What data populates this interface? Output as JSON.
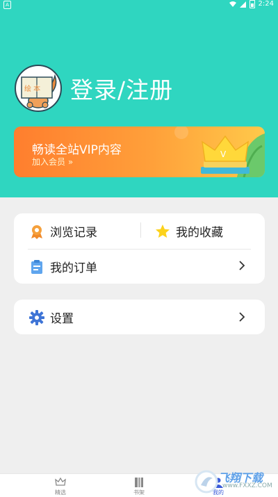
{
  "status_bar": {
    "left_icon": "A",
    "time": "2:24"
  },
  "profile": {
    "login_label": "登录/注册",
    "avatar_book_text": "绘 本"
  },
  "vip": {
    "title": "畅读全站VIP内容",
    "join": "加入会员 »",
    "badge_letter": "V"
  },
  "menu": {
    "history": "浏览记录",
    "favorites": "我的收藏",
    "orders": "我的订单",
    "settings": "设置"
  },
  "tabs": [
    {
      "label": "精选",
      "icon": "crown-icon"
    },
    {
      "label": "书架",
      "icon": "bookshelf-icon"
    },
    {
      "label": "我的",
      "icon": "user-icon",
      "active": true
    }
  ],
  "watermark": {
    "text": "飞翔下载",
    "url": "www.FXXZ.COM"
  },
  "colors": {
    "header": "#2fd6c0",
    "accent_tab": "#3a5bd9",
    "vip_start": "#ff7e2e",
    "vip_end": "#ffc94a"
  }
}
